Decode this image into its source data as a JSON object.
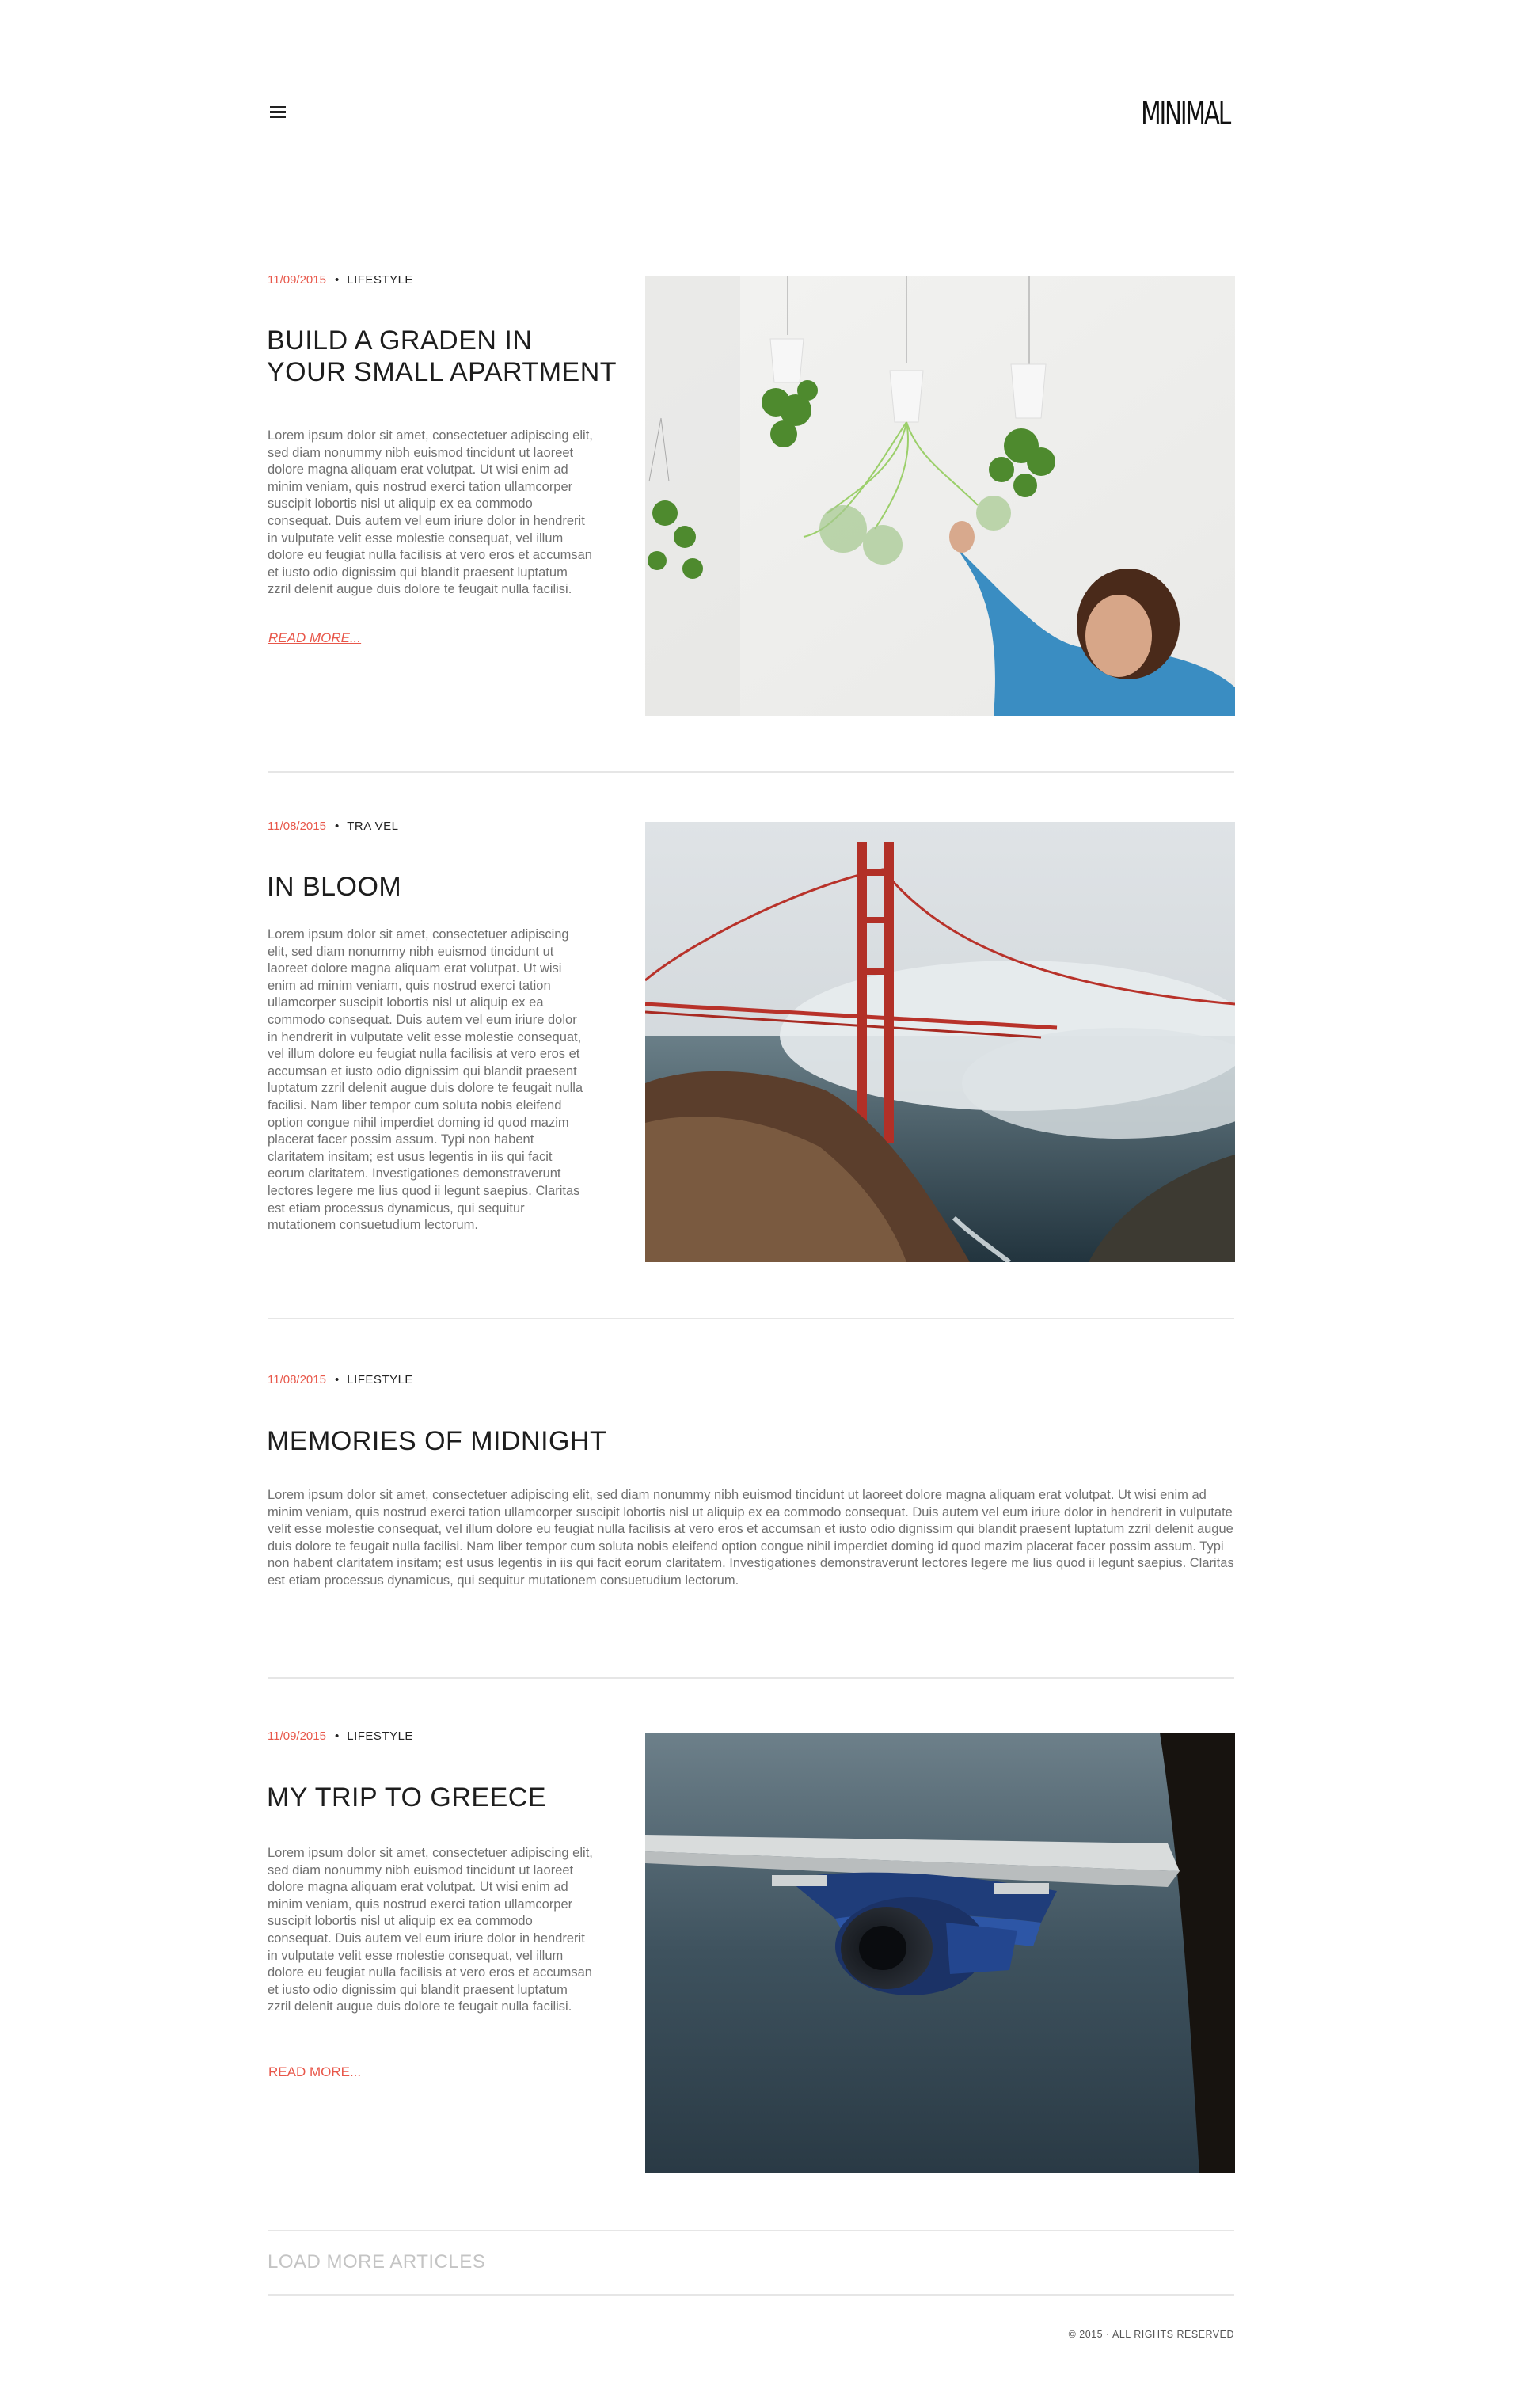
{
  "header": {
    "menu_icon": "hamburger-menu-icon",
    "logo": "MINIMAL"
  },
  "articles": [
    {
      "date": "11/09/2015",
      "separator": "•",
      "category": "LIFESTYLE",
      "title_lines": [
        "BUILD A GRADEN IN",
        "YOUR SMALL APARTMENT"
      ],
      "body": "Lorem ipsum dolor sit amet, consectetuer adipiscing elit, sed diam nonummy nibh euismod tincidunt ut laoreet dolore magna aliquam erat volutpat. Ut wisi enim ad minim veniam, quis nostrud exerci tation ullamcorper suscipit lobortis nisl ut aliquip ex ea commodo consequat. Duis autem vel eum iriure dolor in hendrerit in vulputate velit esse molestie consequat, vel illum dolore eu feugiat nulla facilisis at vero eros et accumsan et iusto odio dignissim qui blandit praesent luptatum zzril delenit augue duis dolore te feugait nulla facilisi.",
      "read_more": "READ MORE...",
      "image": "hanging-plants-photo"
    },
    {
      "date": "11/08/2015",
      "separator": "•",
      "category": "TRA VEL",
      "title_lines": [
        "IN BLOOM"
      ],
      "body": "Lorem ipsum dolor sit amet, consectetuer adipiscing elit, sed diam nonummy nibh euismod tincidunt ut laoreet dolore magna aliquam erat volutpat. Ut wisi enim ad minim veniam, quis nostrud exerci tation ullamcorper suscipit lobortis nisl ut aliquip ex ea commodo consequat. Duis autem vel eum iriure dolor in hendrerit in vulputate velit esse molestie consequat, vel illum dolore eu feugiat nulla facilisis at vero eros et accumsan et iusto odio dignissim qui blandit praesent luptatum zzril delenit augue duis dolore te feugait nulla facilisi. Nam liber tempor cum soluta nobis eleifend option congue nihil imperdiet doming id quod mazim placerat facer possim assum. Typi non habent claritatem insitam; est usus legentis in iis qui facit eorum claritatem. Investigationes demonstraverunt lectores legere me lius quod ii legunt saepius. Claritas est etiam processus dynamicus, qui sequitur mutationem consuetudium lectorum.",
      "image": "golden-gate-bridge-photo"
    },
    {
      "date": "11/08/2015",
      "separator": "•",
      "category": "LIFESTYLE",
      "title_lines": [
        "MEMORIES OF MIDNIGHT"
      ],
      "body": "Lorem ipsum dolor sit amet, consectetuer adipiscing elit, sed diam nonummy nibh euismod tincidunt ut laoreet dolore magna aliquam erat volutpat. Ut wisi enim ad minim veniam, quis nostrud exerci tation ullamcorper suscipit lobortis nisl ut aliquip ex ea commodo consequat. Duis autem vel eum iriure dolor in hendrerit in vulputate velit esse molestie consequat, vel illum dolore eu feugiat nulla facilisis at vero eros et accumsan et iusto odio dignissim qui blandit praesent luptatum zzril delenit augue duis dolore te feugait nulla facilisi. Nam liber tempor cum soluta nobis eleifend option congue nihil imperdiet doming id quod mazim placerat facer possim assum. Typi non habent claritatem insitam; est usus legentis in iis qui facit eorum claritatem. Investigationes demonstraverunt lectores legere me lius quod ii legunt saepius. Claritas est etiam processus dynamicus, qui sequitur mutationem consuetudium lectorum."
    },
    {
      "date": "11/09/2015",
      "separator": "•",
      "category": "LIFESTYLE",
      "title_lines": [
        "MY TRIP TO GREECE"
      ],
      "body": "Lorem ipsum dolor sit amet, consectetuer adipiscing elit, sed diam nonummy nibh euismod tincidunt ut laoreet dolore magna aliquam erat volutpat. Ut wisi enim ad minim veniam, quis nostrud exerci tation ullamcorper suscipit lobortis nisl ut aliquip ex ea commodo consequat. Duis autem vel eum iriure dolor in hendrerit in vulputate velit esse molestie consequat, vel illum dolore eu feugiat nulla facilisis at vero eros et accumsan et iusto odio dignissim qui blandit praesent luptatum zzril delenit augue duis dolore te feugait nulla facilisi.",
      "read_more": "READ MORE...",
      "image": "airplane-wing-photo"
    }
  ],
  "load_more": "LOAD MORE ARTICLES",
  "footer": "© 2015 · ALL RIGHTS RESERVED",
  "colors": {
    "accent": "#e8574a",
    "rule": "#e6e6e6",
    "body_text": "#707070"
  }
}
